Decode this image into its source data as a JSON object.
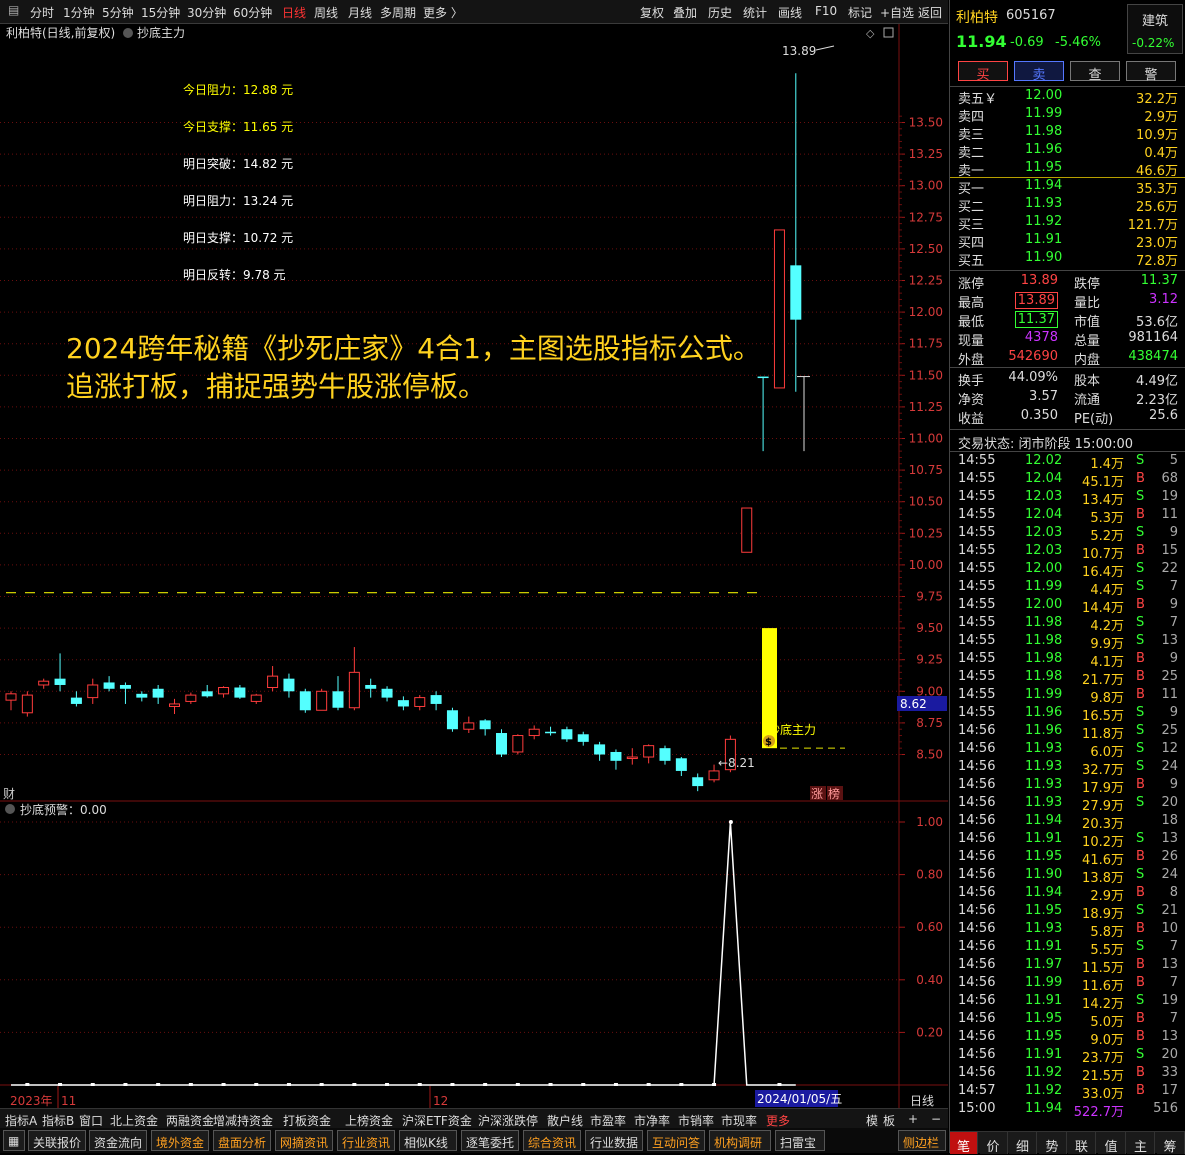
{
  "topbar": {
    "periods": [
      "分时",
      "1分钟",
      "5分钟",
      "15分钟",
      "30分钟",
      "60分钟",
      "日线",
      "周线",
      "月线",
      "多周期",
      "更多 〉"
    ],
    "active_period": "日线",
    "tools": [
      "复权",
      "叠加",
      "历史",
      "统计",
      "画线",
      "F10",
      "标记",
      "+自选",
      "返回"
    ]
  },
  "chart_header": {
    "title": "利柏特(日线,前复权)",
    "indicator": "抄底主力"
  },
  "levels": [
    {
      "label": "今日阻力：12.88 元",
      "color": "#ffff00"
    },
    {
      "label": "今日支撑：11.65 元",
      "color": "#ffff00"
    },
    {
      "label": "明日突破：14.82 元",
      "color": "#ffffff"
    },
    {
      "label": "明日阻力：13.24 元",
      "color": "#ffffff"
    },
    {
      "label": "明日支撑：10.72 元",
      "color": "#ffffff"
    },
    {
      "label": "明日反转：9.78 元",
      "color": "#ffffff"
    }
  ],
  "promo": {
    "line1": "2024跨年秘籍《抄死庄家》4合1，主图选股指标公式。",
    "line2": "追涨打板，捕捉强势牛股涨停板。"
  },
  "annotations": {
    "high": "13.89",
    "low": "8.21",
    "signal": "抄底主力",
    "money_icon": "$",
    "cai": "财",
    "zhang": "涨",
    "bang": "榜",
    "price_tag": "8.62"
  },
  "price_axis": [
    "13.50",
    "13.25",
    "13.00",
    "12.75",
    "12.50",
    "12.25",
    "12.00",
    "11.75",
    "11.50",
    "11.25",
    "11.00",
    "10.75",
    "10.50",
    "10.25",
    "10.00",
    "9.75",
    "9.50",
    "9.25",
    "9.00",
    "8.75",
    "8.50"
  ],
  "sub_chart": {
    "title": "抄底预警：0.00",
    "axis": [
      "1.00",
      "0.80",
      "0.60",
      "0.40",
      "0.20"
    ],
    "peak": 1.0
  },
  "time_axis": {
    "year": "2023年",
    "m11": "11",
    "m12": "12",
    "cursor_date": "2024/01/05/五",
    "period": "日线"
  },
  "bottom_tabs": [
    "指标A",
    "指标B",
    "窗口",
    "北上资金",
    "两融资金",
    "增减持资金",
    "打板资金",
    "上榜资金",
    "沪深ETF资金",
    "沪深涨跌停",
    "散户线",
    "市盈率",
    "市净率",
    "市销率",
    "市现率",
    "更多"
  ],
  "bottom_right": [
    "模",
    "板",
    "+",
    "−"
  ],
  "bottom_buttons": [
    "关联报价",
    "资金流向",
    "境外资金",
    "盘面分析",
    "网摘资讯",
    "行业资讯",
    "相似K线",
    "逐笔委托",
    "综合资讯",
    "行业数据",
    "互动问答",
    "机构调研",
    "扫雷宝"
  ],
  "sidebar_btn": "侧边栏",
  "stock": {
    "name": "利柏特",
    "code": "605167",
    "sector": "建筑",
    "sector_change": "-0.22%",
    "price": "11.94",
    "change": "-0.69",
    "change_pct": "-5.46%"
  },
  "trade_buttons": [
    "买",
    "卖",
    "查",
    "警"
  ],
  "asks": [
    {
      "label": "卖五￥",
      "price": "12.00",
      "vol": "32.2万"
    },
    {
      "label": "卖四",
      "price": "11.99",
      "vol": "2.9万"
    },
    {
      "label": "卖三",
      "price": "11.98",
      "vol": "10.9万"
    },
    {
      "label": "卖二",
      "price": "11.96",
      "vol": "0.4万"
    },
    {
      "label": "卖一",
      "price": "11.95",
      "vol": "46.6万"
    }
  ],
  "bids": [
    {
      "label": "买一",
      "price": "11.94",
      "vol": "35.3万"
    },
    {
      "label": "买二",
      "price": "11.93",
      "vol": "25.6万"
    },
    {
      "label": "买三",
      "price": "11.92",
      "vol": "121.7万"
    },
    {
      "label": "买四",
      "price": "11.91",
      "vol": "23.0万"
    },
    {
      "label": "买五",
      "price": "11.90",
      "vol": "72.8万"
    }
  ],
  "stats": [
    {
      "l1": "涨停",
      "v1": "13.89",
      "c1": "#ff4444",
      "l2": "跌停",
      "v2": "11.37",
      "c2": "#33ff33"
    },
    {
      "l1": "最高",
      "v1": "13.89",
      "c1": "#ff4444",
      "l2": "量比",
      "v2": "3.12",
      "c2": "#cc33ff"
    },
    {
      "l1": "最低",
      "v1": "11.37",
      "c1": "#33ff33",
      "l2": "市值",
      "v2": "53.6亿",
      "c2": "#dddddd"
    },
    {
      "l1": "现量",
      "v1": "4378",
      "c1": "#cc33ff",
      "l2": "总量",
      "v2": "981164",
      "c2": "#dddddd"
    },
    {
      "l1": "外盘",
      "v1": "542690",
      "c1": "#ff4444",
      "l2": "内盘",
      "v2": "438474",
      "c2": "#33ff33"
    }
  ],
  "stats2": [
    {
      "l1": "换手",
      "v1": "44.09%",
      "l2": "股本",
      "v2": "4.49亿"
    },
    {
      "l1": "净资",
      "v1": "3.57",
      "l2": "流通",
      "v2": "2.23亿"
    },
    {
      "l1": "收益",
      "v1": "0.350",
      "l2": "PE(动)",
      "v2": "25.6"
    }
  ],
  "trade_status": "交易状态: 闭市阶段 15:00:00",
  "ticks": [
    [
      "14:55",
      "12.02",
      "1.4万",
      "S",
      "5"
    ],
    [
      "14:55",
      "12.04",
      "45.1万",
      "B",
      "68"
    ],
    [
      "14:55",
      "12.03",
      "13.4万",
      "S",
      "19"
    ],
    [
      "14:55",
      "12.04",
      "5.3万",
      "B",
      "11"
    ],
    [
      "14:55",
      "12.03",
      "5.2万",
      "S",
      "9"
    ],
    [
      "14:55",
      "12.03",
      "10.7万",
      "B",
      "15"
    ],
    [
      "14:55",
      "12.00",
      "16.4万",
      "S",
      "22"
    ],
    [
      "14:55",
      "11.99",
      "4.4万",
      "S",
      "7"
    ],
    [
      "14:55",
      "12.00",
      "14.4万",
      "B",
      "9"
    ],
    [
      "14:55",
      "11.98",
      "4.2万",
      "S",
      "7"
    ],
    [
      "14:55",
      "11.98",
      "9.9万",
      "S",
      "13"
    ],
    [
      "14:55",
      "11.98",
      "4.1万",
      "B",
      "9"
    ],
    [
      "14:55",
      "11.98",
      "21.7万",
      "B",
      "25"
    ],
    [
      "14:55",
      "11.99",
      "9.8万",
      "B",
      "11"
    ],
    [
      "14:55",
      "11.96",
      "16.5万",
      "S",
      "9"
    ],
    [
      "14:56",
      "11.96",
      "11.8万",
      "S",
      "25"
    ],
    [
      "14:56",
      "11.93",
      "6.0万",
      "S",
      "12"
    ],
    [
      "14:56",
      "11.93",
      "32.7万",
      "S",
      "24"
    ],
    [
      "14:56",
      "11.93",
      "17.9万",
      "B",
      "9"
    ],
    [
      "14:56",
      "11.93",
      "27.9万",
      "S",
      "20"
    ],
    [
      "14:56",
      "11.94",
      "20.3万",
      "",
      "18"
    ],
    [
      "14:56",
      "11.91",
      "10.2万",
      "S",
      "13"
    ],
    [
      "14:56",
      "11.95",
      "41.6万",
      "B",
      "26"
    ],
    [
      "14:56",
      "11.90",
      "13.8万",
      "S",
      "24"
    ],
    [
      "14:56",
      "11.94",
      "2.9万",
      "B",
      "8"
    ],
    [
      "14:56",
      "11.95",
      "18.9万",
      "S",
      "21"
    ],
    [
      "14:56",
      "11.93",
      "5.8万",
      "B",
      "10"
    ],
    [
      "14:56",
      "11.91",
      "5.5万",
      "S",
      "7"
    ],
    [
      "14:56",
      "11.97",
      "11.5万",
      "B",
      "13"
    ],
    [
      "14:56",
      "11.99",
      "11.6万",
      "B",
      "7"
    ],
    [
      "14:56",
      "11.91",
      "14.2万",
      "S",
      "19"
    ],
    [
      "14:56",
      "11.95",
      "5.0万",
      "B",
      "7"
    ],
    [
      "14:56",
      "11.95",
      "9.0万",
      "B",
      "13"
    ],
    [
      "14:56",
      "11.91",
      "23.7万",
      "S",
      "20"
    ],
    [
      "14:56",
      "11.92",
      "21.5万",
      "B",
      "33"
    ],
    [
      "14:57",
      "11.92",
      "33.0万",
      "B",
      "17"
    ],
    [
      "15:00",
      "11.94",
      "522.7万",
      "",
      "516"
    ]
  ],
  "side_tabs": [
    "笔",
    "价",
    "细",
    "势",
    "联",
    "值",
    "主",
    "筹"
  ],
  "chart_data": {
    "type": "candlestick",
    "y_range": [
      8.2,
      13.9
    ],
    "candles": [
      [
        8.93,
        8.98,
        8.85,
        9.0
      ],
      [
        8.83,
        8.97,
        8.8,
        9.0
      ],
      [
        9.05,
        9.08,
        9.02,
        9.1
      ],
      [
        9.1,
        9.05,
        9.0,
        9.3
      ],
      [
        8.95,
        8.9,
        8.88,
        9.0
      ],
      [
        8.95,
        9.05,
        8.9,
        9.1
      ],
      [
        9.07,
        9.02,
        9.0,
        9.12
      ],
      [
        9.05,
        9.02,
        8.9,
        9.07
      ],
      [
        8.98,
        8.95,
        8.92,
        9.0
      ],
      [
        9.02,
        8.95,
        8.9,
        9.05
      ],
      [
        8.88,
        8.9,
        8.82,
        8.94
      ],
      [
        8.92,
        8.97,
        8.9,
        8.99
      ],
      [
        9.0,
        8.96,
        8.95,
        9.05
      ],
      [
        8.98,
        9.03,
        8.95,
        9.04
      ],
      [
        9.03,
        8.95,
        8.94,
        9.05
      ],
      [
        8.92,
        8.97,
        8.9,
        8.98
      ],
      [
        9.03,
        9.12,
        9.0,
        9.2
      ],
      [
        9.1,
        9.0,
        8.95,
        9.14
      ],
      [
        9.0,
        8.85,
        8.83,
        9.02
      ],
      [
        8.85,
        9.0,
        8.85,
        9.02
      ],
      [
        9.0,
        8.87,
        8.85,
        9.12
      ],
      [
        8.87,
        9.15,
        8.85,
        9.35
      ],
      [
        9.05,
        9.02,
        8.95,
        9.1
      ],
      [
        9.02,
        8.95,
        8.92,
        9.04
      ],
      [
        8.93,
        8.88,
        8.85,
        8.96
      ],
      [
        8.88,
        8.95,
        8.85,
        8.97
      ],
      [
        8.97,
        8.9,
        8.85,
        9.0
      ],
      [
        8.85,
        8.7,
        8.68,
        8.87
      ],
      [
        8.7,
        8.75,
        8.67,
        8.8
      ],
      [
        8.77,
        8.7,
        8.65,
        8.78
      ],
      [
        8.67,
        8.5,
        8.48,
        8.7
      ],
      [
        8.52,
        8.65,
        8.5,
        8.66
      ],
      [
        8.65,
        8.7,
        8.62,
        8.73
      ],
      [
        8.68,
        8.68,
        8.65,
        8.72
      ],
      [
        8.7,
        8.62,
        8.6,
        8.72
      ],
      [
        8.66,
        8.6,
        8.57,
        8.68
      ],
      [
        8.58,
        8.5,
        8.45,
        8.6
      ],
      [
        8.52,
        8.45,
        8.38,
        8.54
      ],
      [
        8.47,
        8.48,
        8.42,
        8.55
      ],
      [
        8.48,
        8.57,
        8.43,
        8.58
      ],
      [
        8.55,
        8.45,
        8.42,
        8.57
      ],
      [
        8.47,
        8.37,
        8.33,
        8.48
      ],
      [
        8.32,
        8.25,
        8.21,
        8.35
      ],
      [
        8.3,
        8.37,
        8.28,
        8.42
      ],
      [
        8.38,
        8.62,
        8.36,
        8.65
      ],
      [
        10.1,
        10.45,
        10.1,
        10.45
      ],
      [
        11.49,
        11.49,
        10.9,
        11.49
      ],
      [
        11.4,
        12.65,
        11.4,
        12.65
      ],
      [
        12.37,
        11.94,
        11.37,
        13.89
      ]
    ],
    "signal_bar": {
      "from": 8.55,
      "to": 9.5
    },
    "dashed_levels": [
      9.78,
      8.55
    ],
    "sub_series": [
      0,
      0,
      0,
      0,
      0,
      0,
      0,
      0,
      0,
      0,
      0,
      0,
      0,
      0,
      0,
      0,
      0,
      0,
      0,
      0,
      0,
      0,
      0,
      0,
      0,
      0,
      0,
      0,
      0,
      0,
      0,
      0,
      0,
      0,
      0,
      0,
      0,
      0,
      0,
      0,
      0,
      0,
      0,
      0,
      1.0,
      0,
      0,
      0,
      0
    ]
  }
}
